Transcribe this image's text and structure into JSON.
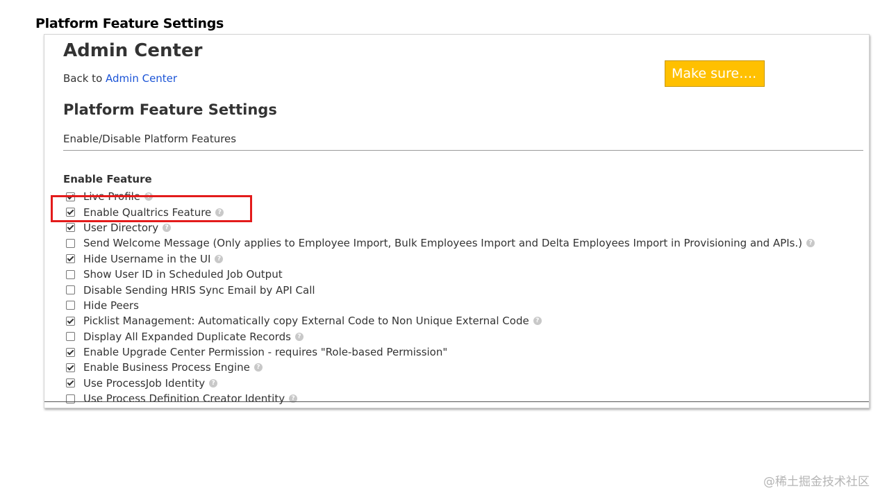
{
  "slide": {
    "title": "Platform Feature Settings"
  },
  "page": {
    "admin_title": "Admin Center",
    "back_prefix": "Back to ",
    "back_link": "Admin Center",
    "section_title": "Platform Feature Settings",
    "subtitle": "Enable/Disable Platform Features",
    "enable_heading": "Enable Feature"
  },
  "features": [
    {
      "label": "Live Profile",
      "checked": true,
      "help": true
    },
    {
      "label": "Enable Qualtrics Feature",
      "checked": true,
      "help": true
    },
    {
      "label": "User Directory",
      "checked": true,
      "help": true
    },
    {
      "label": "Send Welcome Message (Only applies to Employee Import, Bulk Employees Import and Delta Employees Import in Provisioning and APIs.)",
      "checked": false,
      "help": true
    },
    {
      "label": "Hide Username in the UI",
      "checked": true,
      "help": true
    },
    {
      "label": "Show User ID in Scheduled Job Output",
      "checked": false,
      "help": false
    },
    {
      "label": "Disable Sending HRIS Sync Email by API Call",
      "checked": false,
      "help": false
    },
    {
      "label": "Hide Peers",
      "checked": false,
      "help": false
    },
    {
      "label": "Picklist Management: Automatically copy External Code to Non Unique External Code",
      "checked": true,
      "help": true
    },
    {
      "label": "Display All Expanded Duplicate Records",
      "checked": false,
      "help": true
    },
    {
      "label": "Enable Upgrade Center Permission - requires \"Role-based Permission\"",
      "checked": true,
      "help": false
    },
    {
      "label": "Enable Business Process Engine",
      "checked": true,
      "help": true
    },
    {
      "label": "Use ProcessJob Identity",
      "checked": true,
      "help": true
    },
    {
      "label": "Use Process Definition Creator Identity",
      "checked": false,
      "help": true
    }
  ],
  "annotation": {
    "note": "Make sure….",
    "highlight_color": "#e31b1b",
    "note_color": "#ffc000"
  },
  "watermark": "@稀土掘金技术社区",
  "icons": {
    "help": "help-icon",
    "checkbox": "checkbox"
  }
}
